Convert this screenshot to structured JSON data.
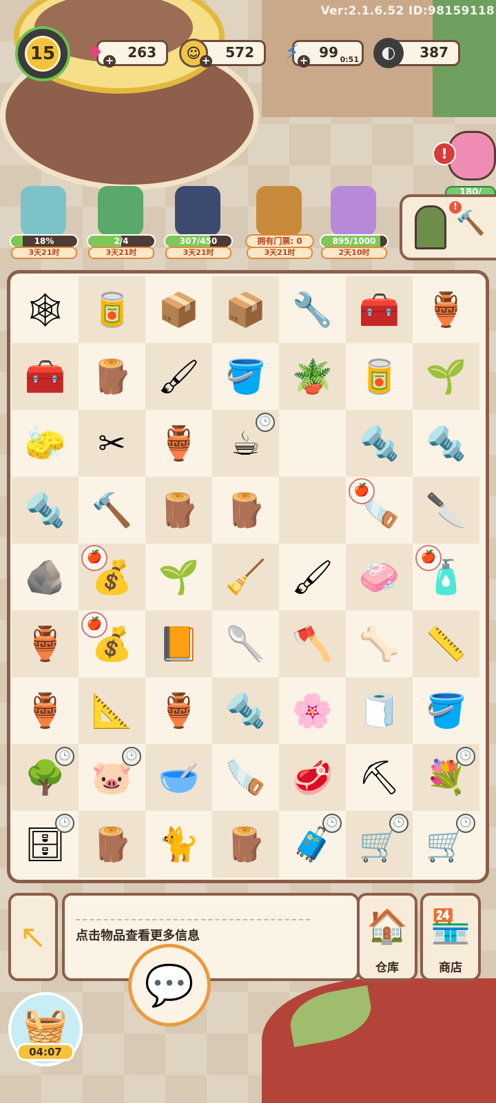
{
  "version": "Ver:2.1.6.52 ID:98159118",
  "player": {
    "level": "15"
  },
  "currencies": {
    "gems": "263",
    "coins": "572",
    "energy": "99",
    "energy_timer": "0:51",
    "seeds": "387"
  },
  "piggy_bank": {
    "progress_text": "180/"
  },
  "events": [
    {
      "progress": "18%",
      "fill": 0.18,
      "time": "3天21时"
    },
    {
      "progress": "2/4",
      "fill": 0.5,
      "time": "3天21时"
    },
    {
      "progress": "307/450",
      "fill": 0.68,
      "time": "3天21时"
    },
    {
      "progress": "拥有门票: 0",
      "fill": 0,
      "time": "3天21时"
    },
    {
      "progress": "895/1000",
      "fill": 0.9,
      "time": "2天10时"
    }
  ],
  "board": {
    "items": [
      [
        "cobweb-crate",
        "paint-can",
        "wooden-tray",
        "cobweb-box",
        "pipe",
        "toolbox",
        "vase"
      ],
      [
        "toolbox-open",
        "logs",
        "paint-tubes",
        "paint-bucket",
        "flower-pot",
        "paint-can",
        "vase-sprout"
      ],
      [
        "brush",
        "pliers",
        "broken-pot",
        "cup",
        "empty",
        "screws",
        "screws"
      ],
      [
        "screw",
        "hammer",
        "planks",
        "planks",
        "empty",
        "saw",
        "knife"
      ],
      [
        "gravel",
        "seed-bag",
        "sprout",
        "dustpan",
        "paint-tubes",
        "soap",
        "spray-bottle"
      ],
      [
        "vase",
        "seed-bag",
        "seed-packet",
        "trowel",
        "axe",
        "pipes",
        "level"
      ],
      [
        "broken-vase",
        "tape-measure",
        "vase",
        "screw",
        "flower-tree",
        "towel",
        "bucket"
      ],
      [
        "tree",
        "piggy",
        "bowl",
        "saw",
        "meat",
        "shovel",
        "flower-bucket"
      ],
      [
        "cabinet",
        "log",
        "black-cat",
        "logs",
        "chest",
        "cart",
        "wheelbarrow"
      ]
    ],
    "icons": {
      "cobweb-crate": "🕸",
      "paint-can": "🥫",
      "wooden-tray": "📦",
      "cobweb-box": "📦",
      "pipe": "🔧",
      "toolbox": "🧰",
      "vase": "🏺",
      "toolbox-open": "🧰",
      "logs": "🪵",
      "paint-tubes": "🖌",
      "paint-bucket": "🪣",
      "flower-pot": "🪴",
      "vase-sprout": "🌱",
      "brush": "🧽",
      "pliers": "✂",
      "broken-pot": "🏺",
      "cup": "☕",
      "empty": "",
      "screws": "🔩",
      "screw": "🔩",
      "hammer": "🔨",
      "planks": "🪵",
      "saw": "🪚",
      "knife": "🔪",
      "gravel": "🪨",
      "seed-bag": "💰",
      "sprout": "🌱",
      "dustpan": "🧹",
      "soap": "🧼",
      "spray-bottle": "🧴",
      "seed-packet": "📙",
      "trowel": "🥄",
      "axe": "🪓",
      "pipes": "🦴",
      "level": "📏",
      "broken-vase": "🏺",
      "tape-measure": "📐",
      "flower-tree": "🌸",
      "towel": "🧻",
      "bucket": "🪣",
      "tree": "🌳",
      "piggy": "🐷",
      "bowl": "🥣",
      "meat": "🥩",
      "shovel": "⛏",
      "flower-bucket": "💐",
      "cabinet": "🗄",
      "log": "🪵",
      "black-cat": "🐈",
      "chest": "🧳",
      "cart": "🛒",
      "wheelbarrow": "🛒"
    },
    "clocks": [
      [
        2,
        3
      ],
      [
        7,
        0
      ],
      [
        7,
        1
      ],
      [
        7,
        6
      ],
      [
        8,
        0
      ],
      [
        8,
        4
      ],
      [
        8,
        5
      ],
      [
        8,
        6
      ]
    ],
    "badges": [
      [
        3,
        5
      ],
      [
        4,
        1
      ],
      [
        4,
        6
      ],
      [
        5,
        1
      ]
    ]
  },
  "info_text": "点击物品查看更多信息",
  "buttons": {
    "warehouse": "仓库",
    "shop": "商店"
  },
  "gift_timer": "04:07"
}
